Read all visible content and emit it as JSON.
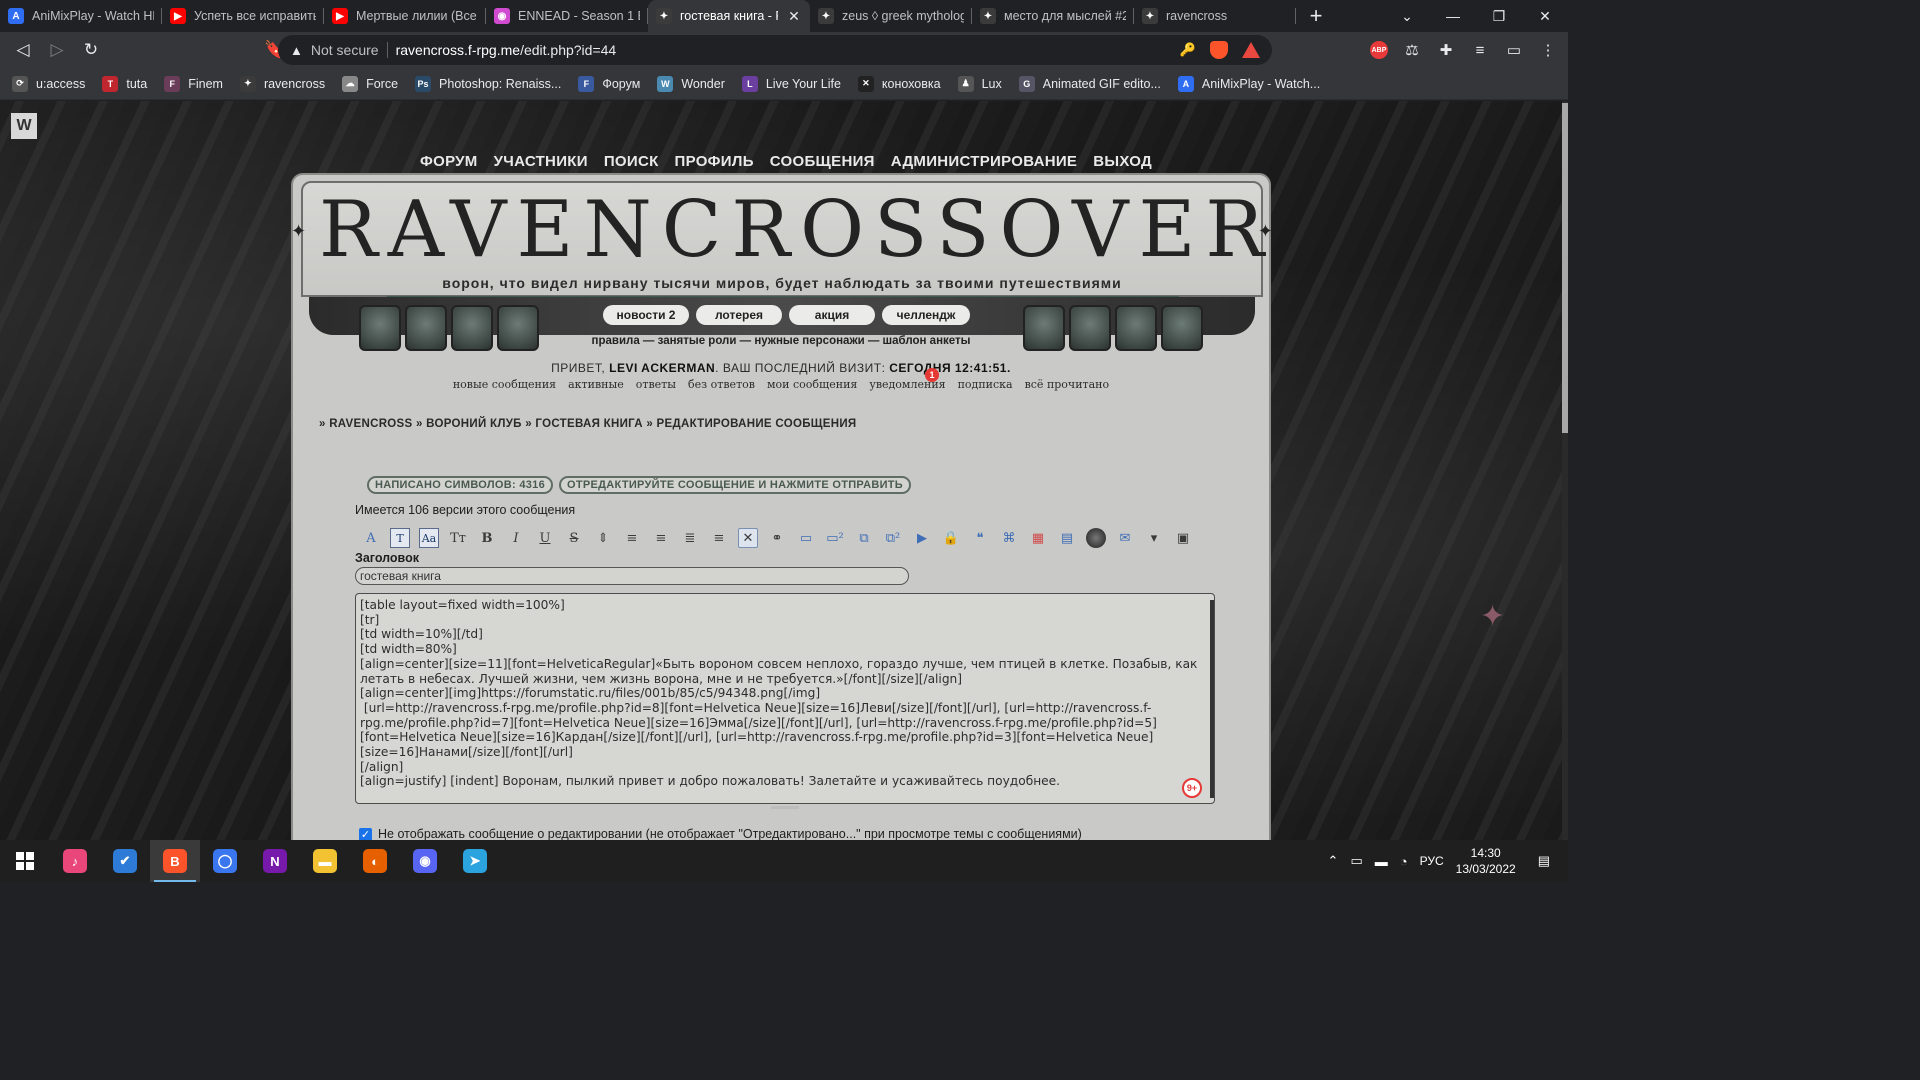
{
  "browser": {
    "tabs": [
      {
        "title": "AniMixPlay - Watch HD",
        "color": "#2f6df2",
        "glyph": "A"
      },
      {
        "title": "Успеть все исправить",
        "color": "#ff0000",
        "glyph": "▶"
      },
      {
        "title": "Мертвые лилии (Все с",
        "color": "#ff0000",
        "glyph": "▶"
      },
      {
        "title": "ENNEAD - Season 1 Ep",
        "color": "#d04bd0",
        "glyph": "◉"
      },
      {
        "title": "гостевая книга - P",
        "color": "#3b3b3b",
        "glyph": "✦",
        "close": "✕"
      },
      {
        "title": "zeus ◊ greek mytholog",
        "color": "#3b3b3b",
        "glyph": "✦"
      },
      {
        "title": "место для мыслей #2",
        "color": "#3b3b3b",
        "glyph": "✦"
      },
      {
        "title": "ravencross",
        "color": "#3b3b3b",
        "glyph": "✦"
      }
    ],
    "new_tab": "+",
    "window_controls": [
      "⌄",
      "—",
      "❐",
      "✕"
    ],
    "toolbar": {
      "back": "◁",
      "forward": "▷",
      "reload": "↻",
      "bookmark": "🔖",
      "warning_icon": "▲",
      "security_label": "Not secure",
      "url_host": "ravencross.f-rpg.me",
      "url_path": "/edit.php?id=44",
      "key_icon": "🔑"
    },
    "extensions": [
      "ABP",
      "⚖",
      "✚",
      "≡",
      "▭",
      "⋮"
    ],
    "bookmarks": [
      {
        "label": "u:access",
        "color": "#555",
        "glyph": "⟳"
      },
      {
        "label": "tuta",
        "color": "#c0262d",
        "glyph": "T"
      },
      {
        "label": "Finem",
        "color": "#6a3c5a",
        "glyph": "F"
      },
      {
        "label": "ravencross",
        "color": "#3b3b3b",
        "glyph": "✦"
      },
      {
        "label": "Force",
        "color": "#888",
        "glyph": "☁"
      },
      {
        "label": "Photoshop: Renaiss...",
        "color": "#2a4a6a",
        "glyph": "Ps"
      },
      {
        "label": "Форум",
        "color": "#3a5aa0",
        "glyph": "F"
      },
      {
        "label": "Wonder",
        "color": "#4a8ab0",
        "glyph": "W"
      },
      {
        "label": "Live Your Life",
        "color": "#6b3fa0",
        "glyph": "L"
      },
      {
        "label": "коноховка",
        "color": "#222",
        "glyph": "✕"
      },
      {
        "label": "Lux",
        "color": "#555",
        "glyph": "♟"
      },
      {
        "label": "Animated GIF edito...",
        "color": "#556",
        "glyph": "G"
      },
      {
        "label": "AniMixPlay - Watch...",
        "color": "#2f6df2",
        "glyph": "A"
      }
    ]
  },
  "page": {
    "corner_badge": "W",
    "top_nav": [
      "ФОРУМ",
      "УЧАСТНИКИ",
      "ПОИСК",
      "ПРОФИЛЬ",
      "СООБЩЕНИЯ",
      "АДМИНИСТРИРОВАНИЕ",
      "ВЫХОД"
    ],
    "banner_title": "RAVENCROSSOVER",
    "banner_subtitle": "ворон, что видел нирвану тысячи миров, будет наблюдать за твоими путешествиями",
    "pills": [
      "новости 2",
      "лотерея",
      "акция",
      "челлендж"
    ],
    "info_links": "правила — занятые роли — нужные персонажи — шаблон анкеты",
    "greeting_prefix": "ПРИВЕТ, ",
    "greeting_user": "LEVI ACKERMAN",
    "greeting_suffix": ".  ВАШ ПОСЛЕДНИЙ ВИЗИТ: ",
    "greeting_time": "СЕГОДНЯ 12:41:51.",
    "user_links": [
      "новые сообщения",
      "активные",
      "ответы",
      "без ответов",
      "мои сообщения",
      "уведомления",
      "подписка",
      "всё прочитано"
    ],
    "notification_count": "1",
    "breadcrumb": "» RAVENCROSS » ВОРОНИЙ КЛУБ » ГОСТЕВАЯ КНИГА » РЕДАКТИРОВАНИЕ СООБЩЕНИЯ",
    "chars_written": "НАПИСАНО СИМВОЛОВ: 4316",
    "edit_hint": "ОТРЕДАКТИРУЙТЕ СООБЩЕНИЕ И НАЖМИТЕ ОТПРАВИТЬ",
    "versions_text": "Имеется 106 версии этого сообщения",
    "subject_label": "Заголовок",
    "subject_value": "гостевая книга",
    "message_lines": [
      "[table layout=fixed width=100%]",
      "[tr]",
      "[td width=10%][/td]",
      "[td width=80%]",
      "[align=center][size=11][font=HelveticaRegular]«Быть вороном совсем неплохо, гораздо лучше, чем птицей в клетке. Позабыв, как летать в небесах. Лучшей жизни, чем жизнь ворона, мне и не требуется.»[/font][/size][/align]",
      "[align=center][img]https://forumstatic.ru/files/001b/85/c5/94348.png[/img]",
      " [url=http://ravencross.f-rpg.me/profile.php?id=8][font=Helvetica Neue][size=16]Леви[/size][/font][/url], [url=http://ravencross.f-rpg.me/profile.php?id=7][font=Helvetica Neue][size=16]Эмма[/size][/font][/url], [url=http://ravencross.f-rpg.me/profile.php?id=5][font=Helvetica Neue][size=16]Кардан[/size][/font][/url], [url=http://ravencross.f-rpg.me/profile.php?id=3][font=Helvetica Neue][size=16]Нанами[/size][/font][/url]",
      "[/align]",
      "[align=justify] [indent] Воронам, пылкий привет и добро пожаловать! Залетайте и усаживайтесь поудобнее."
    ],
    "grammar_badge": "9+",
    "checkbox_label": "Не отображать сообщение о редактировании (не отображает \"Отредактировано...\" при просмотре темы с сообщениями)",
    "checkbox_checked": true
  },
  "taskbar": {
    "apps": [
      {
        "name": "start",
        "glyph": ""
      },
      {
        "name": "itunes",
        "glyph": "♪",
        "color": "#e9467a"
      },
      {
        "name": "todo",
        "glyph": "✔",
        "color": "#2d7bd6"
      },
      {
        "name": "brave",
        "glyph": "B",
        "color": "#fb542b",
        "active": true
      },
      {
        "name": "signal",
        "glyph": "◯",
        "color": "#3a76f0"
      },
      {
        "name": "onenote",
        "glyph": "N",
        "color": "#7719aa"
      },
      {
        "name": "explorer",
        "glyph": "▬",
        "color": "#f2c233"
      },
      {
        "name": "firefox",
        "glyph": "◐",
        "color": "#e66000"
      },
      {
        "name": "discord",
        "glyph": "◉",
        "color": "#5865f2"
      },
      {
        "name": "telegram",
        "glyph": "➤",
        "color": "#2aa3df"
      }
    ],
    "lang": "РУС",
    "time": "14:30",
    "date": "13/03/2022"
  }
}
